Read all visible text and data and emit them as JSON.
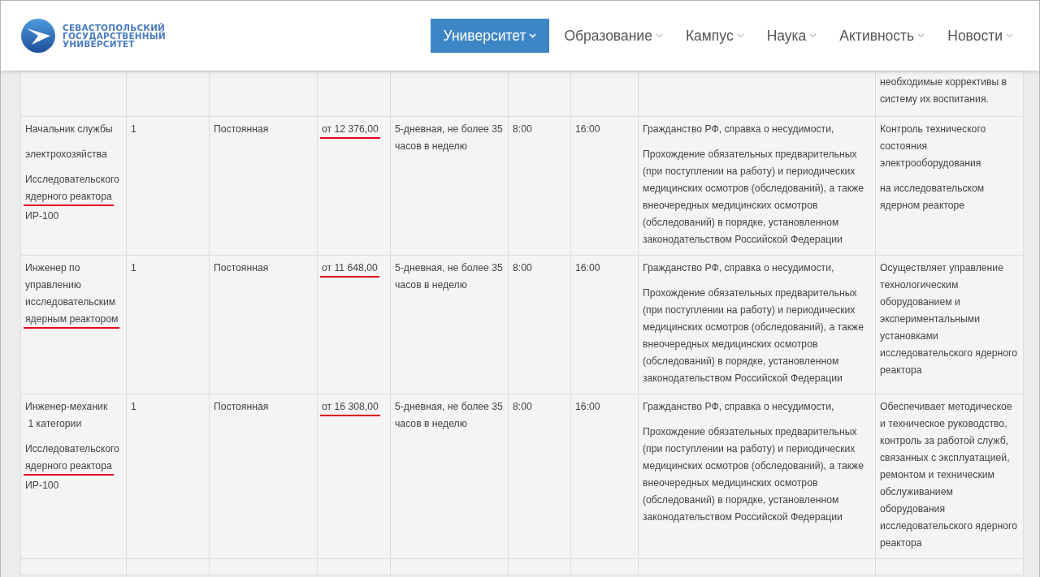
{
  "header": {
    "logo_lines": [
      "СЕВАСТОПОЛЬСКИЙ",
      "ГОСУДАРСТВЕННЫЙ",
      "УНИВЕРСИТЕТ"
    ],
    "nav": [
      {
        "label": "Университет",
        "selected": true
      },
      {
        "label": "Образование",
        "selected": false
      },
      {
        "label": "Кампус",
        "selected": false
      },
      {
        "label": "Наука",
        "selected": false
      },
      {
        "label": "Активность",
        "selected": false
      },
      {
        "label": "Новости",
        "selected": false
      }
    ]
  },
  "table": {
    "partial_row": {
      "column_9": "необходимые коррективы в систему их воспитания."
    },
    "rows": [
      {
        "column_1": [
          [
            {
              "text": "Начальник службы",
              "underlined": false
            }
          ],
          [
            {
              "text": "электрохозяйства",
              "underlined": false
            }
          ],
          [
            {
              "text": "Исследовательского",
              "underlined": false
            },
            {
              "text": "ядерного реактора",
              "underlined": true
            },
            {
              "text": "ИР-100",
              "underlined": false
            }
          ]
        ],
        "column_2": "1",
        "column_3": "Постоянная",
        "column_4": {
          "text": "от 12 376,00",
          "underlined": true
        },
        "column_5": "5-дневная, не более 35 часов в неделю",
        "column_6": "8:00",
        "column_7": "16:00",
        "column_8": [
          "Гражданство РФ, справка о несудимости,",
          "Прохождение обязательных предварительных (при поступлении на работу) и периодических медицинских осмотров (обследований), а также внеочередных медицинских осмотров (обследований) в порядке, установленном законодательством Российской Федерации"
        ],
        "column_9": [
          "Контроль технического состояния электрооборудования",
          "на исследовательском ядерном реакторе"
        ]
      },
      {
        "column_1": [
          [
            {
              "text": "Инженер по",
              "underlined": false
            },
            {
              "text": "управлению",
              "underlined": false
            },
            {
              "text": "исследовательским",
              "underlined": false
            },
            {
              "text": "ядерным реактором",
              "underlined": true
            }
          ]
        ],
        "column_2": "1",
        "column_3": "Постоянная",
        "column_4": {
          "text": "от 11 648,00",
          "underlined": true
        },
        "column_5": "5-дневная, не более 35 часов в неделю",
        "column_6": "8:00",
        "column_7": "16:00",
        "column_8": [
          "Гражданство РФ, справка о несудимости,",
          "Прохождение обязательных предварительных (при поступлении на работу) и периодических медицинских осмотров (обследований), а также внеочередных медицинских осмотров (обследований) в порядке, установленном законодательством Российской Федерации"
        ],
        "column_9": [
          "Осуществляет управление технологическим оборудованием и экспериментальными установками исследовательского ядерного реактора"
        ]
      },
      {
        "column_1": [
          [
            {
              "text": "Инженер-механик",
              "underlined": false
            },
            {
              "text": " 1 категории",
              "underlined": false
            }
          ],
          [
            {
              "text": "Исследовательского",
              "underlined": false
            },
            {
              "text": "ядерного реактора",
              "underlined": true
            },
            {
              "text": "ИР-100",
              "underlined": false
            }
          ]
        ],
        "column_2": "1",
        "column_3": "Постоянная",
        "column_4": {
          "text": "от 16 308,00",
          "underlined": true
        },
        "column_5": "5-дневная, не более 35 часов в неделю",
        "column_6": "8:00",
        "column_7": "16:00",
        "column_8": [
          "Гражданство РФ, справка о несудимости,",
          "Прохождение обязательных предварительных (при поступлении на работу) и периодических медицинских осмотров (обследований), а также внеочередных медицинских осмотров (обследований) в порядке, установленном законодательством Российской Федерации"
        ],
        "column_9": [
          "Обеспечивает методическое и техническое руководство, контроль за работой служб, связанных с эксплуатацией, ремонтом и техническим обслуживанием оборудования исследовательского ядерного реактора"
        ]
      }
    ]
  }
}
